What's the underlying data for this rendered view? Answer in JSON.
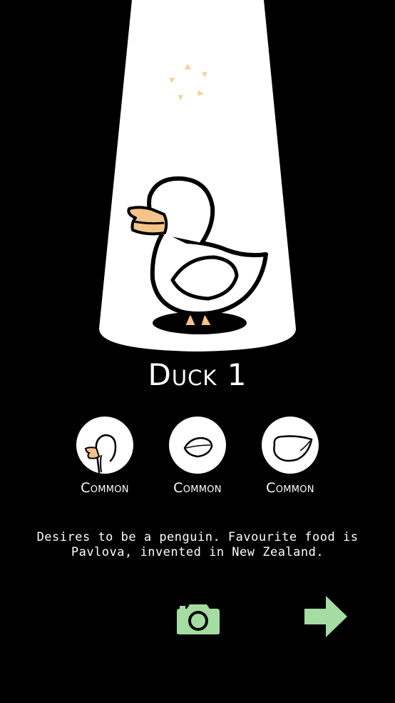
{
  "duck": {
    "name": "Duck 1",
    "description_line1": "Desires to be a penguin. Favourite food is",
    "description_line2": "Pavlova, invented in New Zealand."
  },
  "traits": [
    {
      "label": "Common",
      "icon": "duck-head-icon"
    },
    {
      "label": "Common",
      "icon": "duck-wing-icon"
    },
    {
      "label": "Common",
      "icon": "duck-body-icon"
    }
  ],
  "colors": {
    "background": "#000000",
    "spotlight": "#ffffff",
    "beak": "#f3c38a",
    "sparkle": "#f2d49a",
    "button_green": "#a5dca1"
  },
  "actions": {
    "camera_icon": "camera-icon",
    "next_icon": "arrow-right-icon"
  }
}
